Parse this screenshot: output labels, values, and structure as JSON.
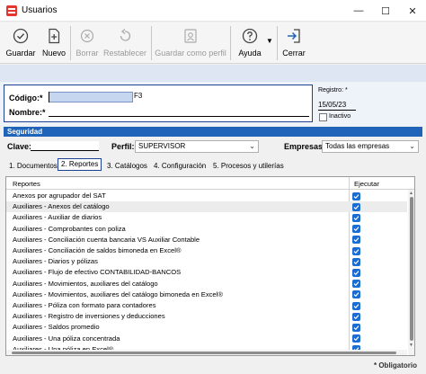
{
  "window": {
    "title": "Usuarios",
    "minimize": "—",
    "maximize": "☐",
    "close": "✕"
  },
  "toolbar": {
    "guardar": "Guardar",
    "nuevo": "Nuevo",
    "borrar": "Borrar",
    "restablecer": "Restablecer",
    "guardar_perfil": "Guardar como perfil",
    "ayuda": "Ayuda",
    "cerrar": "Cerrar"
  },
  "form": {
    "codigo_label": "Código:*",
    "codigo_value": "",
    "f3_hint": "F3",
    "nombre_label": "Nombre:*",
    "nombre_value": "",
    "registro_label": "Registro: *",
    "registro_value": "15/05/23",
    "inactivo_label": "Inactivo",
    "inactivo_checked": false
  },
  "seguridad": {
    "title": "Seguridad",
    "clave_label": "Clave:",
    "clave_value": "",
    "perfil_label": "Perfil:",
    "perfil_value": "SUPERVISOR",
    "empresas_label": "Empresas:",
    "empresas_value": "Todas las empresas"
  },
  "tabs": [
    {
      "label": "1. Documentos",
      "active": false
    },
    {
      "label": "2. Reportes",
      "active": true
    },
    {
      "label": "3. Catálogos",
      "active": false
    },
    {
      "label": "4. Configuración",
      "active": false
    },
    {
      "label": "5. Procesos y utilerías",
      "active": false
    }
  ],
  "grid": {
    "col_reportes": "Reportes",
    "col_ejecutar": "Ejecutar",
    "rows": [
      {
        "name": "Anexos por agrupador del SAT",
        "checked": true
      },
      {
        "name": "Auxiliares - Anexos del catálogo",
        "checked": true
      },
      {
        "name": "Auxiliares - Auxiliar de diarios",
        "checked": true
      },
      {
        "name": "Auxiliares - Comprobantes con poliza",
        "checked": true
      },
      {
        "name": "Auxiliares - Conciliación cuenta bancaria VS Auxiliar Contable",
        "checked": true
      },
      {
        "name": "Auxiliares - Conciliación de saldos bimoneda en Excel®",
        "checked": true
      },
      {
        "name": "Auxiliares - Diarios y pólizas",
        "checked": true
      },
      {
        "name": "Auxiliares - Flujo de efectivo CONTABILIDAD-BANCOS",
        "checked": true
      },
      {
        "name": "Auxiliares - Movimientos, auxiliares del catálogo",
        "checked": true
      },
      {
        "name": "Auxiliares - Movimientos, auxiliares del catálogo bimoneda en Excel®",
        "checked": true
      },
      {
        "name": "Auxiliares - Póliza con formato para contadores",
        "checked": true
      },
      {
        "name": "Auxiliares - Registro de inversiones y deducciones",
        "checked": true
      },
      {
        "name": "Auxiliares - Saldos promedio",
        "checked": true
      },
      {
        "name": "Auxiliares - Una póliza concentrada",
        "checked": true
      },
      {
        "name": "Auxiliares - Una póliza en Excel®",
        "checked": true
      }
    ]
  },
  "footer": {
    "obligatorio": "* Obligatorio"
  },
  "colors": {
    "accent": "#1f64b8",
    "border_blue": "#1f3f90",
    "band": "#dfe6f3",
    "checkbox": "#1a6dd4"
  }
}
